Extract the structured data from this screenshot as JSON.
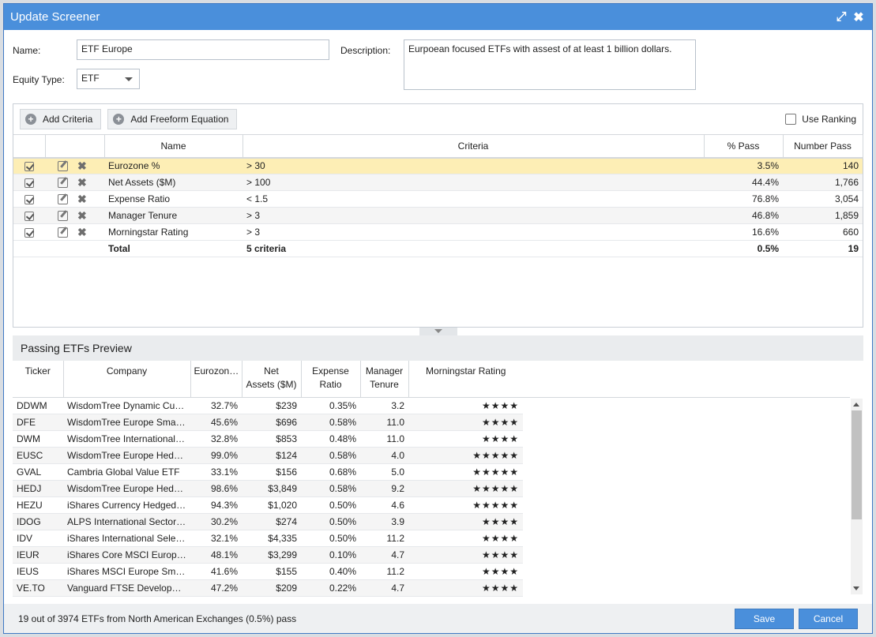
{
  "dialog": {
    "title": "Update Screener",
    "expand_icon": "expand-icon",
    "close_icon": "close-icon"
  },
  "form": {
    "name_label": "Name:",
    "name_value": "ETF Europe",
    "description_label": "Description:",
    "description_value": "Eurpoean focused ETFs with assest of at least 1 billion dollars.",
    "equity_type_label": "Equity Type:",
    "equity_type_value": "ETF"
  },
  "toolbar": {
    "add_criteria": "Add Criteria",
    "add_freeform": "Add Freeform Equation",
    "use_ranking": "Use Ranking"
  },
  "criteria_table": {
    "headers": {
      "name": "Name",
      "criteria": "Criteria",
      "pct_pass": "% Pass",
      "number_pass": "Number Pass"
    },
    "rows": [
      {
        "name": "Eurozone %",
        "criteria": "> 30",
        "pct_pass": "3.5%",
        "number_pass": "140"
      },
      {
        "name": "Net Assets ($M)",
        "criteria": "> 100",
        "pct_pass": "44.4%",
        "number_pass": "1,766"
      },
      {
        "name": "Expense Ratio",
        "criteria": "< 1.5",
        "pct_pass": "76.8%",
        "number_pass": "3,054"
      },
      {
        "name": "Manager Tenure",
        "criteria": "> 3",
        "pct_pass": "46.8%",
        "number_pass": "1,859"
      },
      {
        "name": "Morningstar Rating",
        "criteria": "> 3",
        "pct_pass": "16.6%",
        "number_pass": "660"
      }
    ],
    "total": {
      "name": "Total",
      "criteria": "5 criteria",
      "pct_pass": "0.5%",
      "number_pass": "19"
    }
  },
  "preview": {
    "title": "Passing ETFs Preview",
    "headers": {
      "ticker": "Ticker",
      "company": "Company",
      "eurozone": "Eurozon…",
      "net_assets_1": "Net",
      "net_assets_2": "Assets ($M)",
      "expense_1": "Expense",
      "expense_2": "Ratio",
      "tenure_1": "Manager",
      "tenure_2": "Tenure",
      "rating": "Morningstar Rating"
    },
    "rows": [
      {
        "ticker": "DDWM",
        "company": "WisdomTree Dynamic Cu…",
        "eurozone": "32.7%",
        "net_assets": "$239",
        "expense": "0.35%",
        "tenure": "3.2",
        "rating": "★★★★"
      },
      {
        "ticker": "DFE",
        "company": "WisdomTree Europe Sma…",
        "eurozone": "45.6%",
        "net_assets": "$696",
        "expense": "0.58%",
        "tenure": "11.0",
        "rating": "★★★★"
      },
      {
        "ticker": "DWM",
        "company": "WisdomTree International…",
        "eurozone": "32.8%",
        "net_assets": "$853",
        "expense": "0.48%",
        "tenure": "11.0",
        "rating": "★★★★"
      },
      {
        "ticker": "EUSC",
        "company": "WisdomTree Europe Hed…",
        "eurozone": "99.0%",
        "net_assets": "$124",
        "expense": "0.58%",
        "tenure": "4.0",
        "rating": "★★★★★"
      },
      {
        "ticker": "GVAL",
        "company": "Cambria Global Value ETF",
        "eurozone": "33.1%",
        "net_assets": "$156",
        "expense": "0.68%",
        "tenure": "5.0",
        "rating": "★★★★★"
      },
      {
        "ticker": "HEDJ",
        "company": "WisdomTree Europe Hed…",
        "eurozone": "98.6%",
        "net_assets": "$3,849",
        "expense": "0.58%",
        "tenure": "9.2",
        "rating": "★★★★★"
      },
      {
        "ticker": "HEZU",
        "company": "iShares Currency Hedged…",
        "eurozone": "94.3%",
        "net_assets": "$1,020",
        "expense": "0.50%",
        "tenure": "4.6",
        "rating": "★★★★★"
      },
      {
        "ticker": "IDOG",
        "company": "ALPS International Sector…",
        "eurozone": "30.2%",
        "net_assets": "$274",
        "expense": "0.50%",
        "tenure": "3.9",
        "rating": "★★★★"
      },
      {
        "ticker": "IDV",
        "company": "iShares International Sele…",
        "eurozone": "32.1%",
        "net_assets": "$4,335",
        "expense": "0.50%",
        "tenure": "11.2",
        "rating": "★★★★"
      },
      {
        "ticker": "IEUR",
        "company": "iShares Core MSCI Europ…",
        "eurozone": "48.1%",
        "net_assets": "$3,299",
        "expense": "0.10%",
        "tenure": "4.7",
        "rating": "★★★★"
      },
      {
        "ticker": "IEUS",
        "company": "iShares MSCI Europe Sm…",
        "eurozone": "41.6%",
        "net_assets": "$155",
        "expense": "0.40%",
        "tenure": "11.2",
        "rating": "★★★★"
      },
      {
        "ticker": "VE.TO",
        "company": "Vanguard FTSE Develop…",
        "eurozone": "47.2%",
        "net_assets": "$209",
        "expense": "0.22%",
        "tenure": "4.7",
        "rating": "★★★★"
      }
    ]
  },
  "footer": {
    "status": "19 out of 3974 ETFs from North American Exchanges (0.5%) pass",
    "save": "Save",
    "cancel": "Cancel"
  },
  "colors": {
    "accent": "#4a8fdb",
    "selected_row": "#fdeeb5"
  }
}
